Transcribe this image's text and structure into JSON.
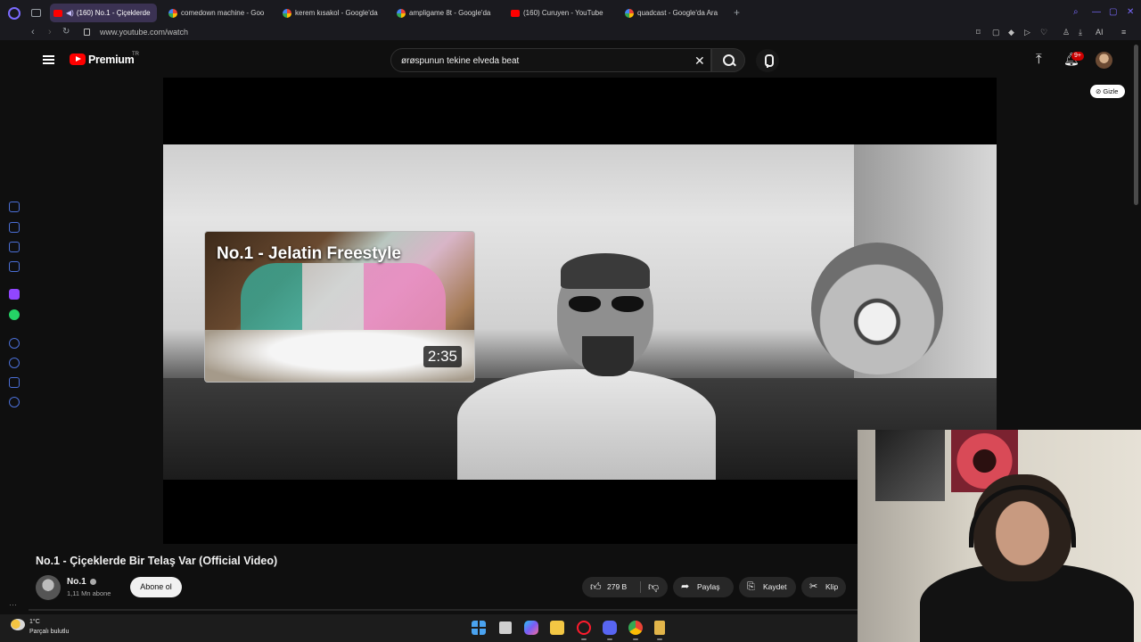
{
  "browser": {
    "tabs": [
      {
        "label": "(160) No.1 - Çiçeklerde",
        "favicon": "youtube",
        "active": true,
        "audio": true
      },
      {
        "label": "comedown machine - Goo",
        "favicon": "google",
        "active": false
      },
      {
        "label": "kerem kısakol - Google'da",
        "favicon": "google",
        "active": false
      },
      {
        "label": "ampligame 8t - Google'da",
        "favicon": "google",
        "active": false
      },
      {
        "label": "(160) Curuyen - YouTube",
        "favicon": "youtube",
        "active": false
      },
      {
        "label": "quadcast - Google'da Ara",
        "favicon": "google",
        "active": false
      }
    ],
    "url": "www.youtube.com/watch",
    "ai_label": "AI"
  },
  "youtube": {
    "brand": "Premium",
    "country": "TR",
    "search_query": "ørøspunun tekine elveda beat",
    "notification_count": "9+"
  },
  "player": {
    "endscreen_title": "No.1 - Jelatin Freestyle",
    "endscreen_duration": "2:35",
    "hide_label": "Gizle"
  },
  "video": {
    "title": "No.1 - Çiçeklerde Bir Telaş Var (Official Video)",
    "channel": "No.1",
    "subscribers": "1,11 Mn abone",
    "subscribe_label": "Abone ol",
    "likes": "279 B",
    "share_label": "Paylaş",
    "save_label": "Kaydet",
    "clip_label": "Klip"
  },
  "taskbar": {
    "temperature": "1°C",
    "weather_desc": "Parçalı bulutlu"
  },
  "colors": {
    "youtube_red": "#ff0000",
    "opera_accent": "#7b6bff",
    "background": "#0f0f0f"
  },
  "icons": [
    "search-icon",
    "mic-icon",
    "upload-icon",
    "bell-icon",
    "like-icon",
    "dislike-icon",
    "share-icon",
    "save-icon",
    "clip-icon",
    "close-icon"
  ]
}
